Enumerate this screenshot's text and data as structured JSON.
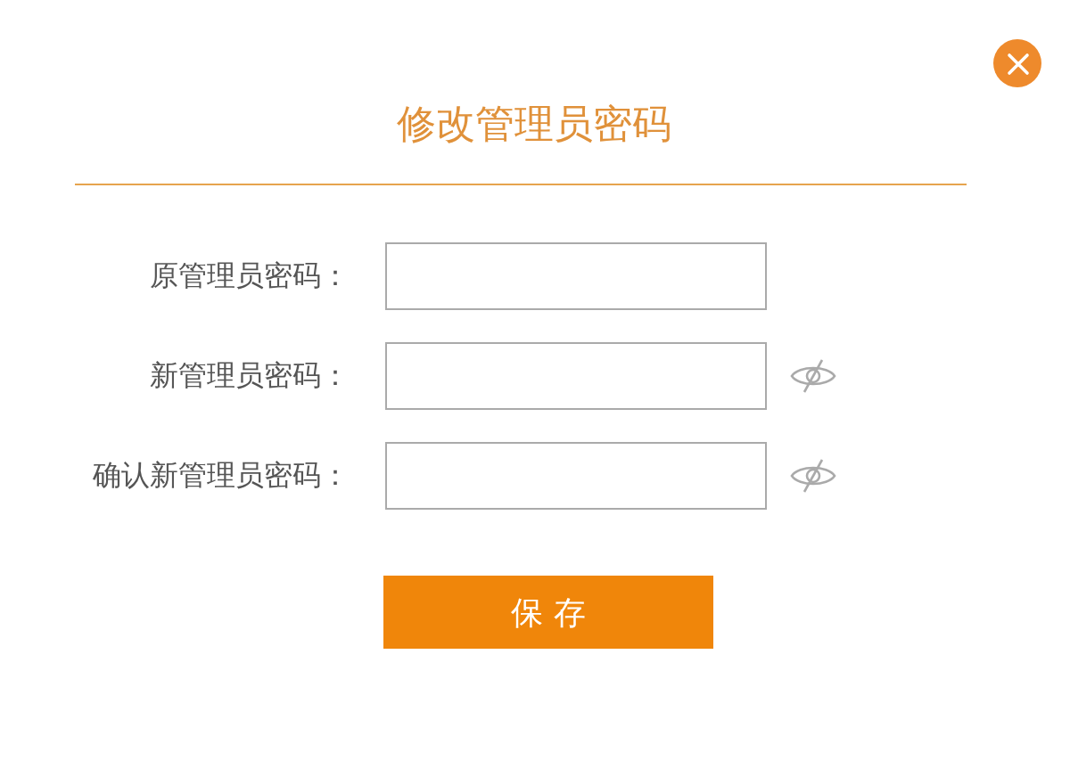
{
  "dialog": {
    "title": "修改管理员密码",
    "fields": [
      {
        "label": "原管理员密码：",
        "kind": "plain"
      },
      {
        "label": "新管理员密码：",
        "kind": "toggle",
        "visible": false
      },
      {
        "label": "确认新管理员密码：",
        "kind": "toggle",
        "visible": false
      }
    ],
    "save_button": "保 存"
  }
}
